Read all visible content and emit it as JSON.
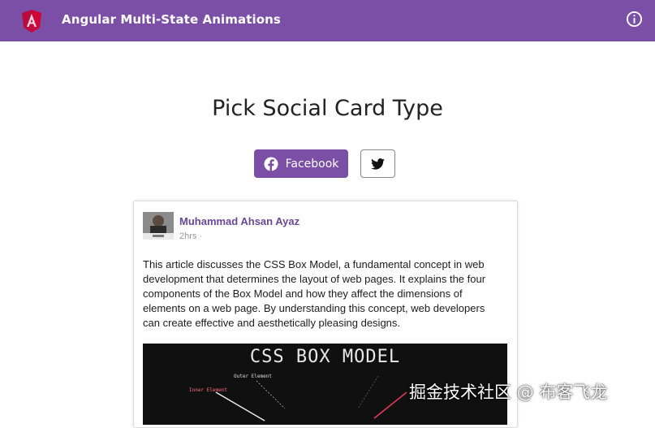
{
  "header": {
    "title": "Angular Multi-State Animations",
    "logo_icon": "angular-logo-icon",
    "info_icon": "info-icon",
    "background_color": "#7b4fa6"
  },
  "main": {
    "heading": "Pick Social Card Type",
    "buttons": {
      "facebook_label": "Facebook",
      "facebook_icon": "facebook-icon",
      "twitter_icon": "twitter-icon",
      "active": "facebook"
    }
  },
  "card": {
    "author": "Muhammad Ahsan Ayaz",
    "time": "2hrs",
    "time_separator": "·",
    "text": "This article discusses the CSS Box Model, a fundamental concept in web development that determines the layout of web pages. It explains the four components of the Box Model and how they affect the dimensions of elements on a web page. By understanding this concept, web developers can create effective and aesthetically pleasing designs.",
    "image": {
      "title": "CSS BOX MODEL",
      "label_outer": "Outer Element",
      "label_inner": "Inner Element"
    },
    "author_color": "#6a4796"
  },
  "watermark": "掘金技术社区 @ 布客飞龙"
}
